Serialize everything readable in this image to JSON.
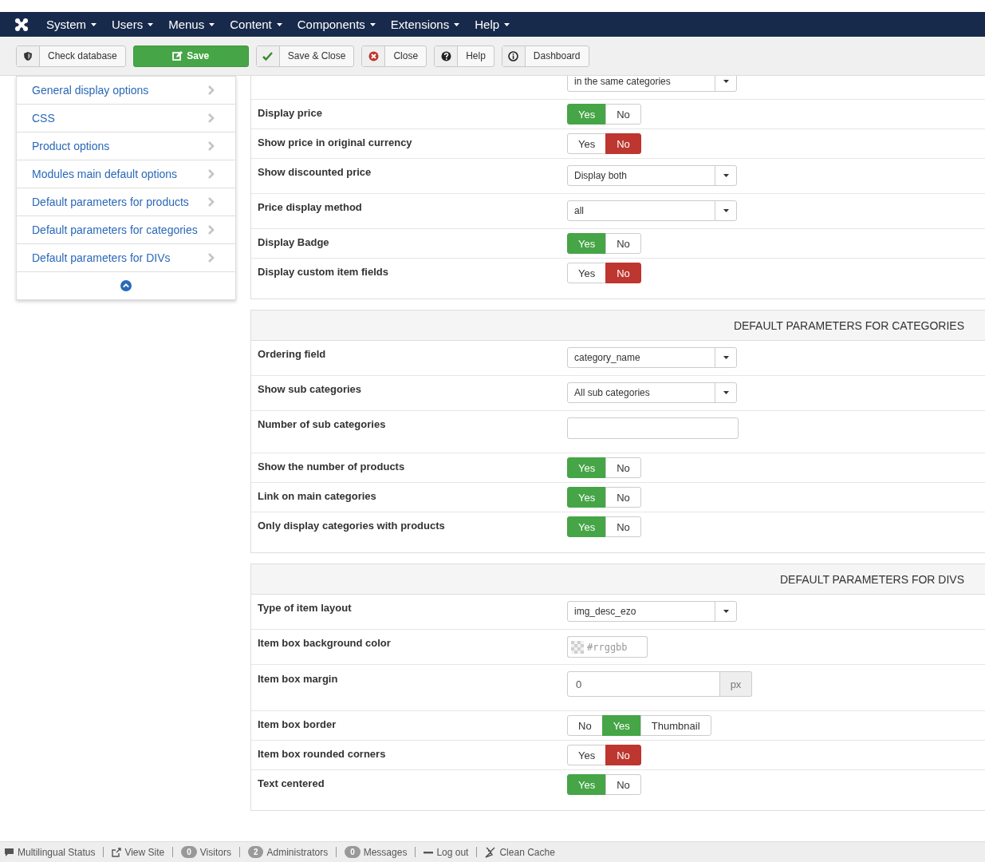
{
  "navbar": {
    "menus": [
      {
        "label": "System"
      },
      {
        "label": "Users"
      },
      {
        "label": "Menus"
      },
      {
        "label": "Content"
      },
      {
        "label": "Components"
      },
      {
        "label": "Extensions"
      },
      {
        "label": "Help"
      }
    ]
  },
  "toolbar": {
    "buttons": [
      {
        "label": "Check database",
        "kind": "plain"
      },
      {
        "label": "Save",
        "kind": "primary"
      },
      {
        "label": "Save & Close",
        "kind": "plain"
      },
      {
        "label": "Close",
        "kind": "plain"
      },
      {
        "label": "Help",
        "kind": "plain"
      },
      {
        "label": "Dashboard",
        "kind": "plain"
      }
    ]
  },
  "sidebar": {
    "items": [
      {
        "label": "General display options"
      },
      {
        "label": "CSS"
      },
      {
        "label": "Product options"
      },
      {
        "label": "Modules main default options"
      },
      {
        "label": "Default parameters for products"
      },
      {
        "label": "Default parameters for categories"
      },
      {
        "label": "Default parameters for DIVs"
      }
    ]
  },
  "sections": [
    {
      "rows": [
        {
          "kind": "select",
          "value": "in the same categories"
        },
        {
          "kind": "toggle",
          "label": "Display price",
          "options": [
            {
              "label": "Yes",
              "selected": true,
              "color": "#46a546"
            },
            {
              "label": "No",
              "selected": false
            }
          ]
        },
        {
          "kind": "toggle",
          "label": "Show price in original currency",
          "options": [
            {
              "label": "Yes",
              "selected": false
            },
            {
              "label": "No",
              "selected": true,
              "color": "#bd362f"
            }
          ]
        },
        {
          "kind": "select",
          "label": "Show discounted price",
          "value": "Display both"
        },
        {
          "kind": "select",
          "label": "Price display method",
          "value": "all"
        },
        {
          "kind": "toggle",
          "label": "Display Badge",
          "options": [
            {
              "label": "Yes",
              "selected": true,
              "color": "#46a546"
            },
            {
              "label": "No",
              "selected": false
            }
          ]
        },
        {
          "kind": "toggle",
          "label": "Display custom item fields",
          "options": [
            {
              "label": "Yes",
              "selected": false
            },
            {
              "label": "No",
              "selected": true,
              "color": "#bd362f"
            }
          ]
        }
      ]
    },
    {
      "title": "DEFAULT PARAMETERS FOR CATEGORIES",
      "rows": [
        {
          "kind": "select",
          "label": "Ordering field",
          "value": "category_name"
        },
        {
          "kind": "select",
          "label": "Show sub categories",
          "value": "All sub categories"
        },
        {
          "kind": "text",
          "label": "Number of sub categories"
        },
        {
          "kind": "toggle",
          "label": "Show the number of products",
          "options": [
            {
              "label": "Yes",
              "selected": true,
              "color": "#46a546"
            },
            {
              "label": "No",
              "selected": false
            }
          ]
        },
        {
          "kind": "toggle",
          "label": "Link on main categories",
          "options": [
            {
              "label": "Yes",
              "selected": true,
              "color": "#46a546"
            },
            {
              "label": "No",
              "selected": false
            }
          ]
        },
        {
          "kind": "toggle",
          "label": "Only display categories with products",
          "options": [
            {
              "label": "Yes",
              "selected": true,
              "color": "#46a546"
            },
            {
              "label": "No",
              "selected": false
            }
          ]
        }
      ]
    },
    {
      "title": "DEFAULT PARAMETERS FOR DIVS",
      "rows": [
        {
          "kind": "select",
          "label": "Type of item layout",
          "value": "img_desc_ezo"
        },
        {
          "kind": "color",
          "label": "Item box background color",
          "placeholder": "#rrggbb"
        },
        {
          "kind": "addon",
          "label": "Item box margin",
          "value": "0",
          "addon": "px"
        },
        {
          "kind": "toggle",
          "label": "Item box border",
          "options": [
            {
              "label": "No",
              "selected": false
            },
            {
              "label": "Yes",
              "selected": true,
              "color": "#46a546"
            },
            {
              "label": "Thumbnail",
              "selected": false
            }
          ]
        },
        {
          "kind": "toggle",
          "label": "Item box rounded corners",
          "options": [
            {
              "label": "Yes",
              "selected": false
            },
            {
              "label": "No",
              "selected": true,
              "color": "#bd362f"
            }
          ]
        },
        {
          "kind": "toggle",
          "label": "Text centered",
          "options": [
            {
              "label": "Yes",
              "selected": true,
              "color": "#46a546"
            },
            {
              "label": "No",
              "selected": false
            }
          ]
        }
      ]
    }
  ],
  "status_bar": {
    "items": [
      {
        "label": "Multilingual Status"
      },
      {
        "label": "View Site"
      },
      {
        "label": "Visitors",
        "count": "0"
      },
      {
        "label": "Administrators",
        "count": "2"
      },
      {
        "label": "Messages",
        "count": "0"
      },
      {
        "label": "Log out"
      },
      {
        "label": "Clean Cache"
      }
    ]
  }
}
